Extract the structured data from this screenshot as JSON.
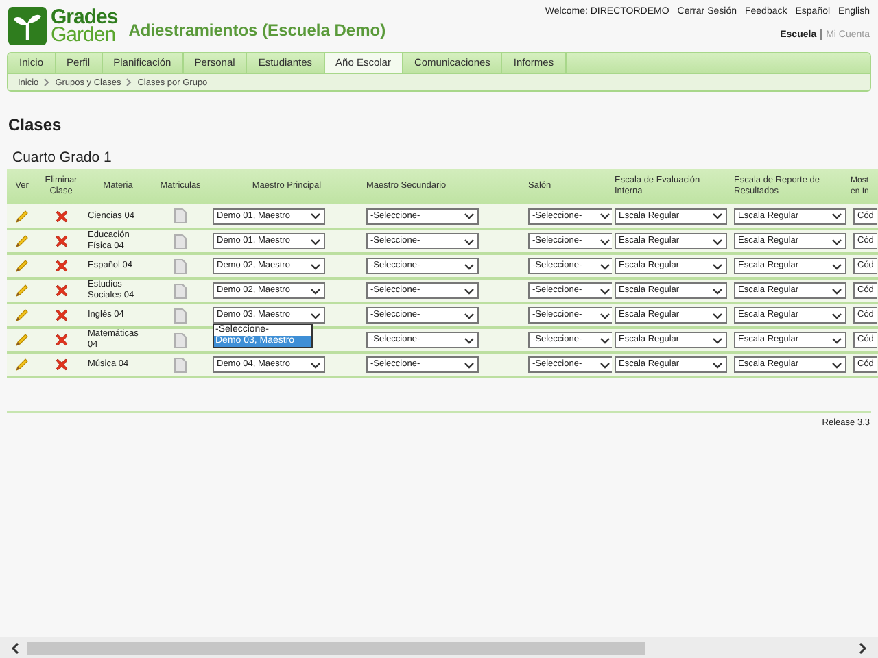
{
  "logo": {
    "line1": "Grades",
    "line2": "Garden"
  },
  "title": "Adiestramientos (Escuela Demo)",
  "user_links": [
    "Welcome: DIRECTORDEMO",
    "Cerrar Sesión",
    "Feedback",
    "Español",
    "English"
  ],
  "context_links": [
    {
      "label": "Escuela",
      "selected": true
    },
    {
      "label": "Mi Cuenta",
      "selected": false
    }
  ],
  "tabs": [
    {
      "label": "Inicio",
      "selected": false
    },
    {
      "label": "Perfil",
      "selected": false
    },
    {
      "label": "Planificación",
      "selected": false
    },
    {
      "label": "Personal",
      "selected": false
    },
    {
      "label": "Estudiantes",
      "selected": false
    },
    {
      "label": "Año Escolar",
      "selected": true
    },
    {
      "label": "Comunicaciones",
      "selected": false
    },
    {
      "label": "Informes",
      "selected": false
    }
  ],
  "breadcrumbs": [
    "Inicio",
    "Grupos y Clases",
    "Clases por Grupo"
  ],
  "page_title": "Clases",
  "section_title": "Cuarto Grado 1",
  "columns": [
    "Ver",
    "Eliminar Clase",
    "Materia",
    "Matriculas",
    "Maestro Principal",
    "Maestro Secundario",
    "Salón",
    "Escala de Evaluación Interna",
    "Escala de Reporte de Resultados",
    "Most en In"
  ],
  "rows": [
    {
      "subject": "Ciencias 04",
      "principal": {
        "value": "Demo 01, Maestro"
      },
      "secondary": "-Seleccione-",
      "room": "-Seleccione-",
      "eval_scale": "Escala Regular",
      "report_scale": "Escala Regular",
      "column_10": "Cód"
    },
    {
      "subject": "Educación Física 04",
      "principal": {
        "value": "Demo 01, Maestro"
      },
      "secondary": "-Seleccione-",
      "room": "-Seleccione-",
      "eval_scale": "Escala Regular",
      "report_scale": "Escala Regular",
      "column_10": "Cód"
    },
    {
      "subject": "Español 04",
      "principal": {
        "value": "Demo 02, Maestro"
      },
      "secondary": "-Seleccione-",
      "room": "-Seleccione-",
      "eval_scale": "Escala Regular",
      "report_scale": "Escala Regular",
      "column_10": "Cód"
    },
    {
      "subject": "Estudios Sociales 04",
      "principal": {
        "value": "Demo 02, Maestro"
      },
      "secondary": "-Seleccione-",
      "room": "-Seleccione-",
      "eval_scale": "Escala Regular",
      "report_scale": "Escala Regular",
      "column_10": "Cód"
    },
    {
      "subject": "Inglés 04",
      "principal": {
        "value": "Demo 03, Maestro",
        "options": [
          {
            "label": "-Seleccione-",
            "selected": false
          },
          {
            "label": "Demo 03, Maestro",
            "selected": true
          }
        ]
      },
      "secondary": "-Seleccione-",
      "room": "-Seleccione-",
      "eval_scale": "Escala Regular",
      "report_scale": "Escala Regular",
      "column_10": "Cód"
    },
    {
      "subject": "Matemáticas 04",
      "principal": {},
      "secondary": "-Seleccione-",
      "room": "-Seleccione-",
      "eval_scale": "Escala Regular",
      "report_scale": "Escala Regular",
      "column_10": "Cód"
    },
    {
      "subject": "Música 04",
      "principal": {
        "value": "Demo 04, Maestro"
      },
      "secondary": "-Seleccione-",
      "room": "-Seleccione-",
      "eval_scale": "Escala Regular",
      "report_scale": "Escala Regular",
      "column_10": "Cód"
    }
  ],
  "footer": "Release 3.3"
}
